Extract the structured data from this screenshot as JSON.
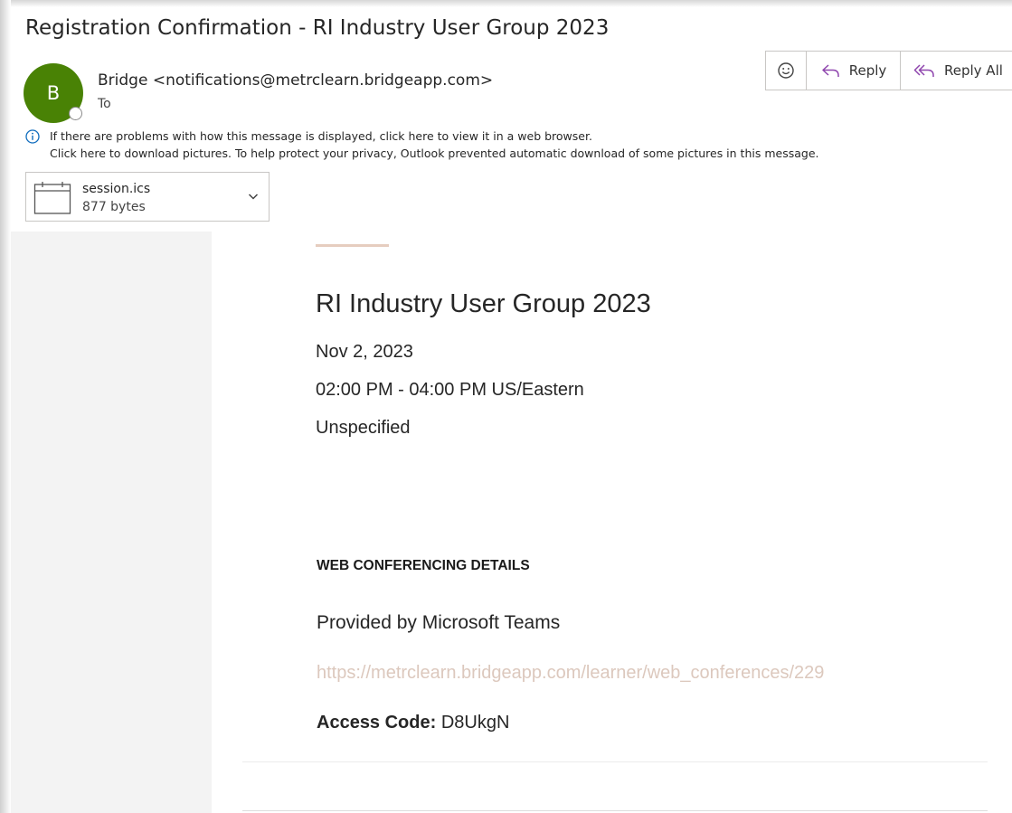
{
  "subject": "Registration Confirmation - RI Industry User Group 2023",
  "sender": {
    "avatar_initial": "B",
    "display": "Bridge <notifications@metrclearn.bridgeapp.com>",
    "to_label": "To"
  },
  "actions": {
    "emoji_icon": "smiley-icon",
    "reply_label": "Reply",
    "reply_all_label": "Reply All"
  },
  "infobar": {
    "line1": "If there are problems with how this message is displayed, click here to view it in a web browser.",
    "line2": "Click here to download pictures. To help protect your privacy, Outlook prevented automatic download of some pictures in this message."
  },
  "attachment": {
    "name": "session.ics",
    "size": "877 bytes"
  },
  "event": {
    "title": "RI Industry User Group 2023",
    "date": "Nov 2, 2023",
    "time": "02:00 PM - 04:00 PM US/Eastern",
    "location": "Unspecified"
  },
  "conferencing": {
    "heading": "WEB CONFERENCING DETAILS",
    "provider": "Provided by Microsoft Teams",
    "link": "https://metrclearn.bridgeapp.com/learner/web_conferences/229",
    "access_label": "Access Code:",
    "access_code": "D8UkgN"
  },
  "colors": {
    "avatar": "#498205",
    "accent": "#e6cdbf",
    "link": "#dcc8bd",
    "reply_icon": "#8e44ad",
    "info_icon": "#0f6cbd"
  }
}
